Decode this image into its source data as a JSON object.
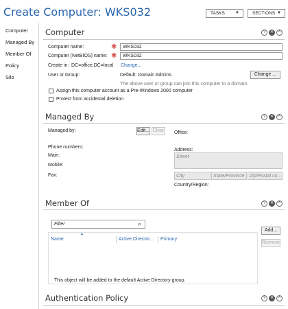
{
  "header": {
    "title": "Create Computer: WKS032",
    "tasks_label": "TASKS",
    "sections_label": "SECTIONS"
  },
  "sidebar": {
    "items": [
      {
        "label": "Computer"
      },
      {
        "label": "Managed By"
      },
      {
        "label": "Member Of"
      },
      {
        "label": "Policy"
      },
      {
        "label": "Silo"
      }
    ]
  },
  "computer": {
    "title": "Computer",
    "name_label": "Computer name:",
    "name_value": "WKS032",
    "netbios_label": "Computer (NetBIOS) name:",
    "netbios_value": "WKS032",
    "create_in_label": "Create in:",
    "create_in_value": "DC=office,DC=local",
    "change_link": "Change...",
    "user_group_label": "User or Group:",
    "user_group_value": "Default: Domain Admins",
    "change_button": "Change ...",
    "user_group_note": "The above user or group can join this computer to a domain",
    "pre2000_label": "Assign this computer account as a Pre-Windows 2000 computer",
    "protect_label": "Protect from accidental deletion"
  },
  "managed_by": {
    "title": "Managed By",
    "managed_by_label": "Managed by:",
    "edit_button": "Edit...",
    "clear_button": "Clear",
    "office_label": "Office:",
    "phone_label": "Phone numbers:",
    "main_label": "Main:",
    "mobile_label": "Mobile:",
    "fax_label": "Fax:",
    "address_label": "Address:",
    "street_placeholder": "Street",
    "city_placeholder": "City",
    "state_placeholder": "State/Province",
    "zip_placeholder": "Zip/Postal co...",
    "country_label": "Country/Region:"
  },
  "member_of": {
    "title": "Member Of",
    "filter_placeholder": "Filter",
    "columns": [
      "Name",
      "Active Director...",
      "Primary"
    ],
    "add_button": "Add...",
    "remove_button": "Remove",
    "note": "This object will be added to the default Active Directory group."
  },
  "auth_policy": {
    "title": "Authentication Policy"
  },
  "icons": {
    "help": "help-icon",
    "close": "close-icon",
    "collapse": "collapse-icon"
  }
}
